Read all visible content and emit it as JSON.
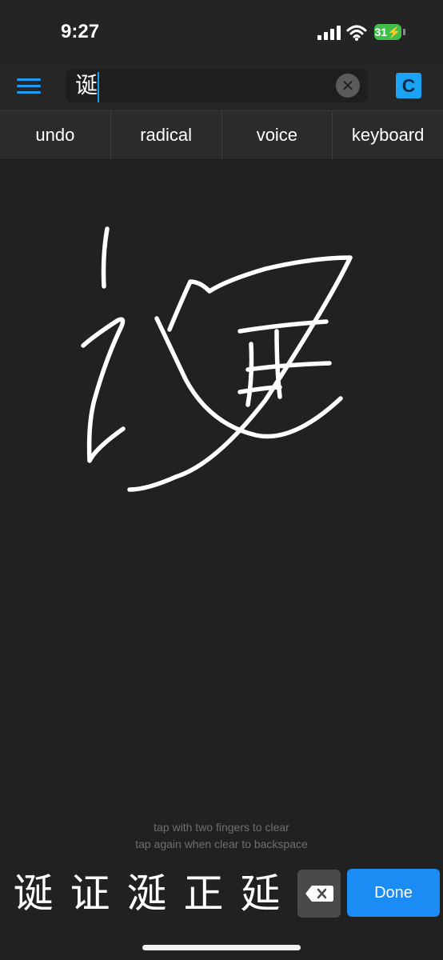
{
  "status_bar": {
    "time": "9:27",
    "battery_level": "31"
  },
  "toolbar": {
    "search_value": "诞",
    "clear_icon": "close-circle-icon",
    "menu_icon": "hamburger-icon",
    "c_label": "C",
    "accent_color": "#1a9bf0"
  },
  "tabs": [
    {
      "label": "undo"
    },
    {
      "label": "radical"
    },
    {
      "label": "voice"
    },
    {
      "label": "keyboard"
    }
  ],
  "canvas": {
    "hint_line1": "tap with two fingers to clear",
    "hint_line2": "tap again when clear to backspace"
  },
  "candidates": [
    {
      "char": "诞"
    },
    {
      "char": "证"
    },
    {
      "char": "涎"
    },
    {
      "char": "正"
    },
    {
      "char": "延"
    }
  ],
  "actions": {
    "backspace_icon": "backspace-icon",
    "done_label": "Done",
    "done_color": "#1b8cf3"
  }
}
